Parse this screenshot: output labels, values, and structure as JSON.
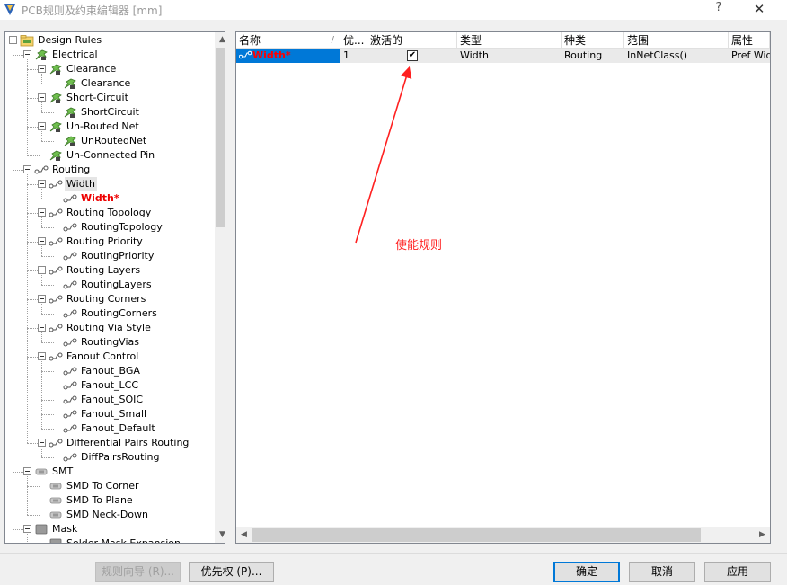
{
  "window": {
    "title": "PCB规则及约束编辑器 [mm]",
    "help_label": "?",
    "close_label": "✕"
  },
  "tree": {
    "rows": [
      {
        "label": "Design Rules",
        "icon": "design-rules-folder-icon"
      },
      {
        "label": "Electrical",
        "icon": "electrical-rule-icon"
      },
      {
        "label": "Clearance",
        "icon": "clearance-rule-icon"
      },
      {
        "label": "Clearance",
        "icon": "clearance-rule-icon"
      },
      {
        "label": "Short-Circuit",
        "icon": "short-circuit-rule-icon"
      },
      {
        "label": "ShortCircuit",
        "icon": "short-circuit-rule-icon"
      },
      {
        "label": "Un-Routed Net",
        "icon": "unrouted-net-rule-icon"
      },
      {
        "label": "UnRoutedNet",
        "icon": "unrouted-net-rule-icon"
      },
      {
        "label": "Un-Connected Pin",
        "icon": "unconnected-pin-rule-icon"
      },
      {
        "label": "Routing",
        "icon": "routing-rule-icon"
      },
      {
        "label": "Width",
        "icon": "routing-rule-icon"
      },
      {
        "label": "Width*",
        "icon": "routing-rule-icon"
      },
      {
        "label": "Routing Topology",
        "icon": "routing-rule-icon"
      },
      {
        "label": "RoutingTopology",
        "icon": "routing-rule-icon"
      },
      {
        "label": "Routing Priority",
        "icon": "routing-rule-icon"
      },
      {
        "label": "RoutingPriority",
        "icon": "routing-rule-icon"
      },
      {
        "label": "Routing Layers",
        "icon": "routing-rule-icon"
      },
      {
        "label": "RoutingLayers",
        "icon": "routing-rule-icon"
      },
      {
        "label": "Routing Corners",
        "icon": "routing-rule-icon"
      },
      {
        "label": "RoutingCorners",
        "icon": "routing-rule-icon"
      },
      {
        "label": "Routing Via Style",
        "icon": "routing-rule-icon"
      },
      {
        "label": "RoutingVias",
        "icon": "routing-rule-icon"
      },
      {
        "label": "Fanout Control",
        "icon": "routing-rule-icon"
      },
      {
        "label": "Fanout_BGA",
        "icon": "routing-rule-icon"
      },
      {
        "label": "Fanout_LCC",
        "icon": "routing-rule-icon"
      },
      {
        "label": "Fanout_SOIC",
        "icon": "routing-rule-icon"
      },
      {
        "label": "Fanout_Small",
        "icon": "routing-rule-icon"
      },
      {
        "label": "Fanout_Default",
        "icon": "routing-rule-icon"
      },
      {
        "label": "Differential Pairs Routing",
        "icon": "routing-rule-icon"
      },
      {
        "label": "DiffPairsRouting",
        "icon": "routing-rule-icon"
      },
      {
        "label": "SMT",
        "icon": "smt-rule-icon"
      },
      {
        "label": "SMD To Corner",
        "icon": "smt-rule-icon"
      },
      {
        "label": "SMD To Plane",
        "icon": "smt-rule-icon"
      },
      {
        "label": "SMD Neck-Down",
        "icon": "smt-rule-icon"
      },
      {
        "label": "Mask",
        "icon": "mask-rule-icon"
      },
      {
        "label": "Solder Mask Expansion",
        "icon": "mask-rule-icon"
      }
    ]
  },
  "grid": {
    "columns": [
      "名称",
      "优...",
      "激活的",
      "类型",
      "种类",
      "范围",
      "属性"
    ],
    "sort_indicator": "/",
    "rows": [
      {
        "name": "Width*",
        "priority": "1",
        "enabled": true,
        "enabled_mark": "✔",
        "type": "Width",
        "kind": "Routing",
        "scope": "InNetClass()",
        "attributes": "Pref Widt"
      }
    ]
  },
  "annotation": {
    "text": "使能规则",
    "color": "#ff2020"
  },
  "buttons": {
    "rule_wizard": "规则向导 (R)...",
    "priorities": "优先权 (P)...",
    "ok": "确定",
    "cancel": "取消",
    "apply": "应用"
  },
  "scroll": {
    "up_arrow": "▲",
    "down_arrow": "▼",
    "left_arrow": "◀",
    "right_arrow": "▶"
  },
  "colors": {
    "selection": "#0078d7",
    "active_rule_text": "#ee0000"
  }
}
